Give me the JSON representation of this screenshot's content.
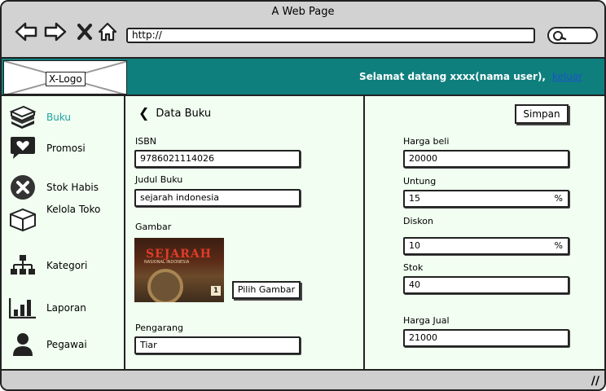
{
  "browser": {
    "title": "A Web Page",
    "url": "http://"
  },
  "header": {
    "logo": "X-Logo",
    "welcome": "Selamat datang xxxx(nama user),",
    "logout": "keluar",
    "bg_color": "#0f7f7e"
  },
  "sidebar": {
    "items": [
      {
        "label": "Buku",
        "icon": "books-icon",
        "active": true
      },
      {
        "label": "Promosi",
        "icon": "heart-chat-icon"
      },
      {
        "label": "Stok Habis",
        "icon": "close-circle-icon"
      },
      {
        "label": "Kelola Toko",
        "icon": "box-icon"
      },
      {
        "label": "Kategori",
        "icon": "sitemap-icon"
      },
      {
        "label": "Laporan",
        "icon": "bar-chart-icon"
      },
      {
        "label": "Pegawai",
        "icon": "user-icon"
      }
    ]
  },
  "form": {
    "back_label": "Data Buku",
    "save_label": "Simpan",
    "isbn_label": "ISBN",
    "isbn_value": "9786021114026",
    "judul_label": "Judul Buku",
    "judul_value": "sejarah  indonesia",
    "gambar_label": "Gambar",
    "pilih_gambar_label": "Pilih Gambar",
    "pengarang_label": "Pengarang",
    "pengarang_value": "Tiar",
    "harga_beli_label": "Harga beli",
    "harga_beli_value": "20000",
    "untung_label": "Untung",
    "untung_value": "15",
    "diskon_label": "Diskon",
    "diskon_value": "10",
    "percent": "%",
    "stok_label": "Stok",
    "stok_value": "40",
    "harga_jual_label": "Harga Jual",
    "harga_jual_value": "21000"
  },
  "cover": {
    "title": "SEJARAH",
    "subtitle": "NASIONAL INDONESIA",
    "volume": "1"
  }
}
